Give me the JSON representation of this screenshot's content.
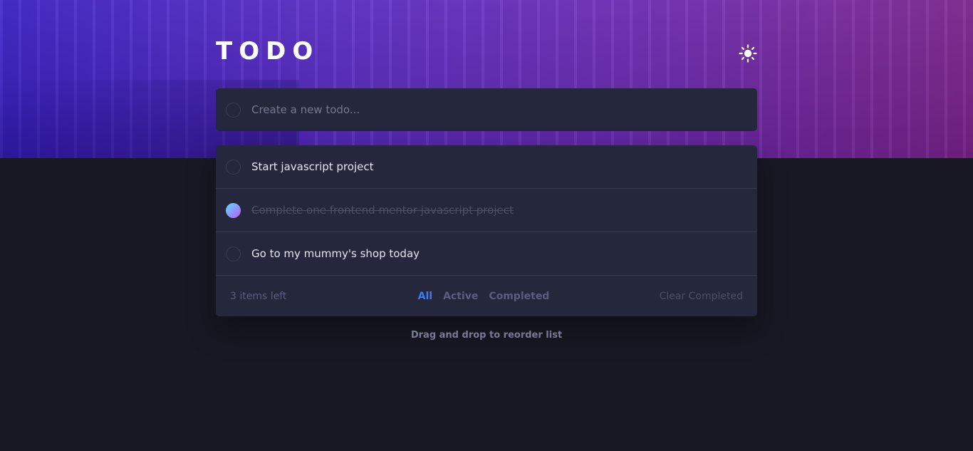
{
  "app": {
    "title": "TODO"
  },
  "theme_toggle": {
    "icon": "sun-icon"
  },
  "new_todo": {
    "placeholder": "Create a new todo...",
    "value": ""
  },
  "todos": [
    {
      "text": "Start javascript project",
      "completed": false
    },
    {
      "text": "Complete one frontend mentor javascript project",
      "completed": true
    },
    {
      "text": "Go to my mummy's shop today",
      "completed": false
    }
  ],
  "footer": {
    "items_left": "3 items left",
    "filters": [
      "All",
      "Active",
      "Completed"
    ],
    "active_filter": "All",
    "clear_label": "Clear Completed"
  },
  "hint": "Drag and drop to reorder list",
  "colors": {
    "background": "#181824",
    "card": "#25273c",
    "accent": "#3a7cfd",
    "check_gradient_start": "#57ddff",
    "check_gradient_end": "#c058f3"
  }
}
